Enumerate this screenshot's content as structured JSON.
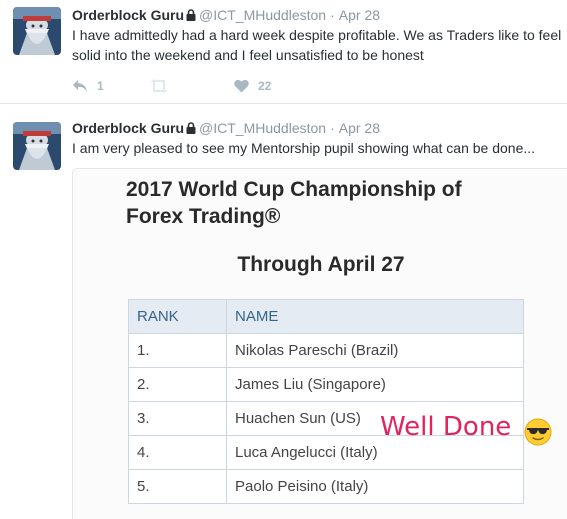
{
  "tweets": [
    {
      "name": "Orderblock Guru",
      "handle": "@ICT_MHuddleston",
      "separator": "·",
      "date": "Apr 28",
      "text_line1": "I have admittedly had a hard week despite profitable.  We as Traders like to feel",
      "text_line2": "solid into the weekend and I feel unsatisfied to be honest",
      "reply_count": "1",
      "retweet_count": "",
      "like_count": "22"
    },
    {
      "name": "Orderblock Guru",
      "handle": "@ICT_MHuddleston",
      "separator": "·",
      "date": "Apr 28",
      "text_line1": "I am very pleased to see my Mentorship pupil showing what can be done..."
    }
  ],
  "media": {
    "title_line1": "2017 World Cup Championship of",
    "title_line2": "Forex Trading®",
    "subtitle": "Through April 27",
    "table": {
      "headers": [
        "RANK",
        "NAME"
      ],
      "rows": [
        [
          "1.",
          "Nikolas Pareschi (Brazil)"
        ],
        [
          "2.",
          "James Liu (Singapore)"
        ],
        [
          "3.",
          "Huachen Sun (US)"
        ],
        [
          "4.",
          "Luca Angelucci (Italy)"
        ],
        [
          "5.",
          "Paolo Peisino (Italy)"
        ]
      ]
    },
    "annotation": "Well Done",
    "annotation_color": "#e0245e"
  },
  "icons": [
    "avatar",
    "lock-icon",
    "reply-icon",
    "retweet-icon",
    "heart-icon",
    "sunglasses-emoji"
  ],
  "colors": {
    "meta_gray": "#8899a6",
    "action_gray": "#aab8c2",
    "table_header_bg": "#e4ebf3",
    "table_header_text": "#36648b"
  }
}
